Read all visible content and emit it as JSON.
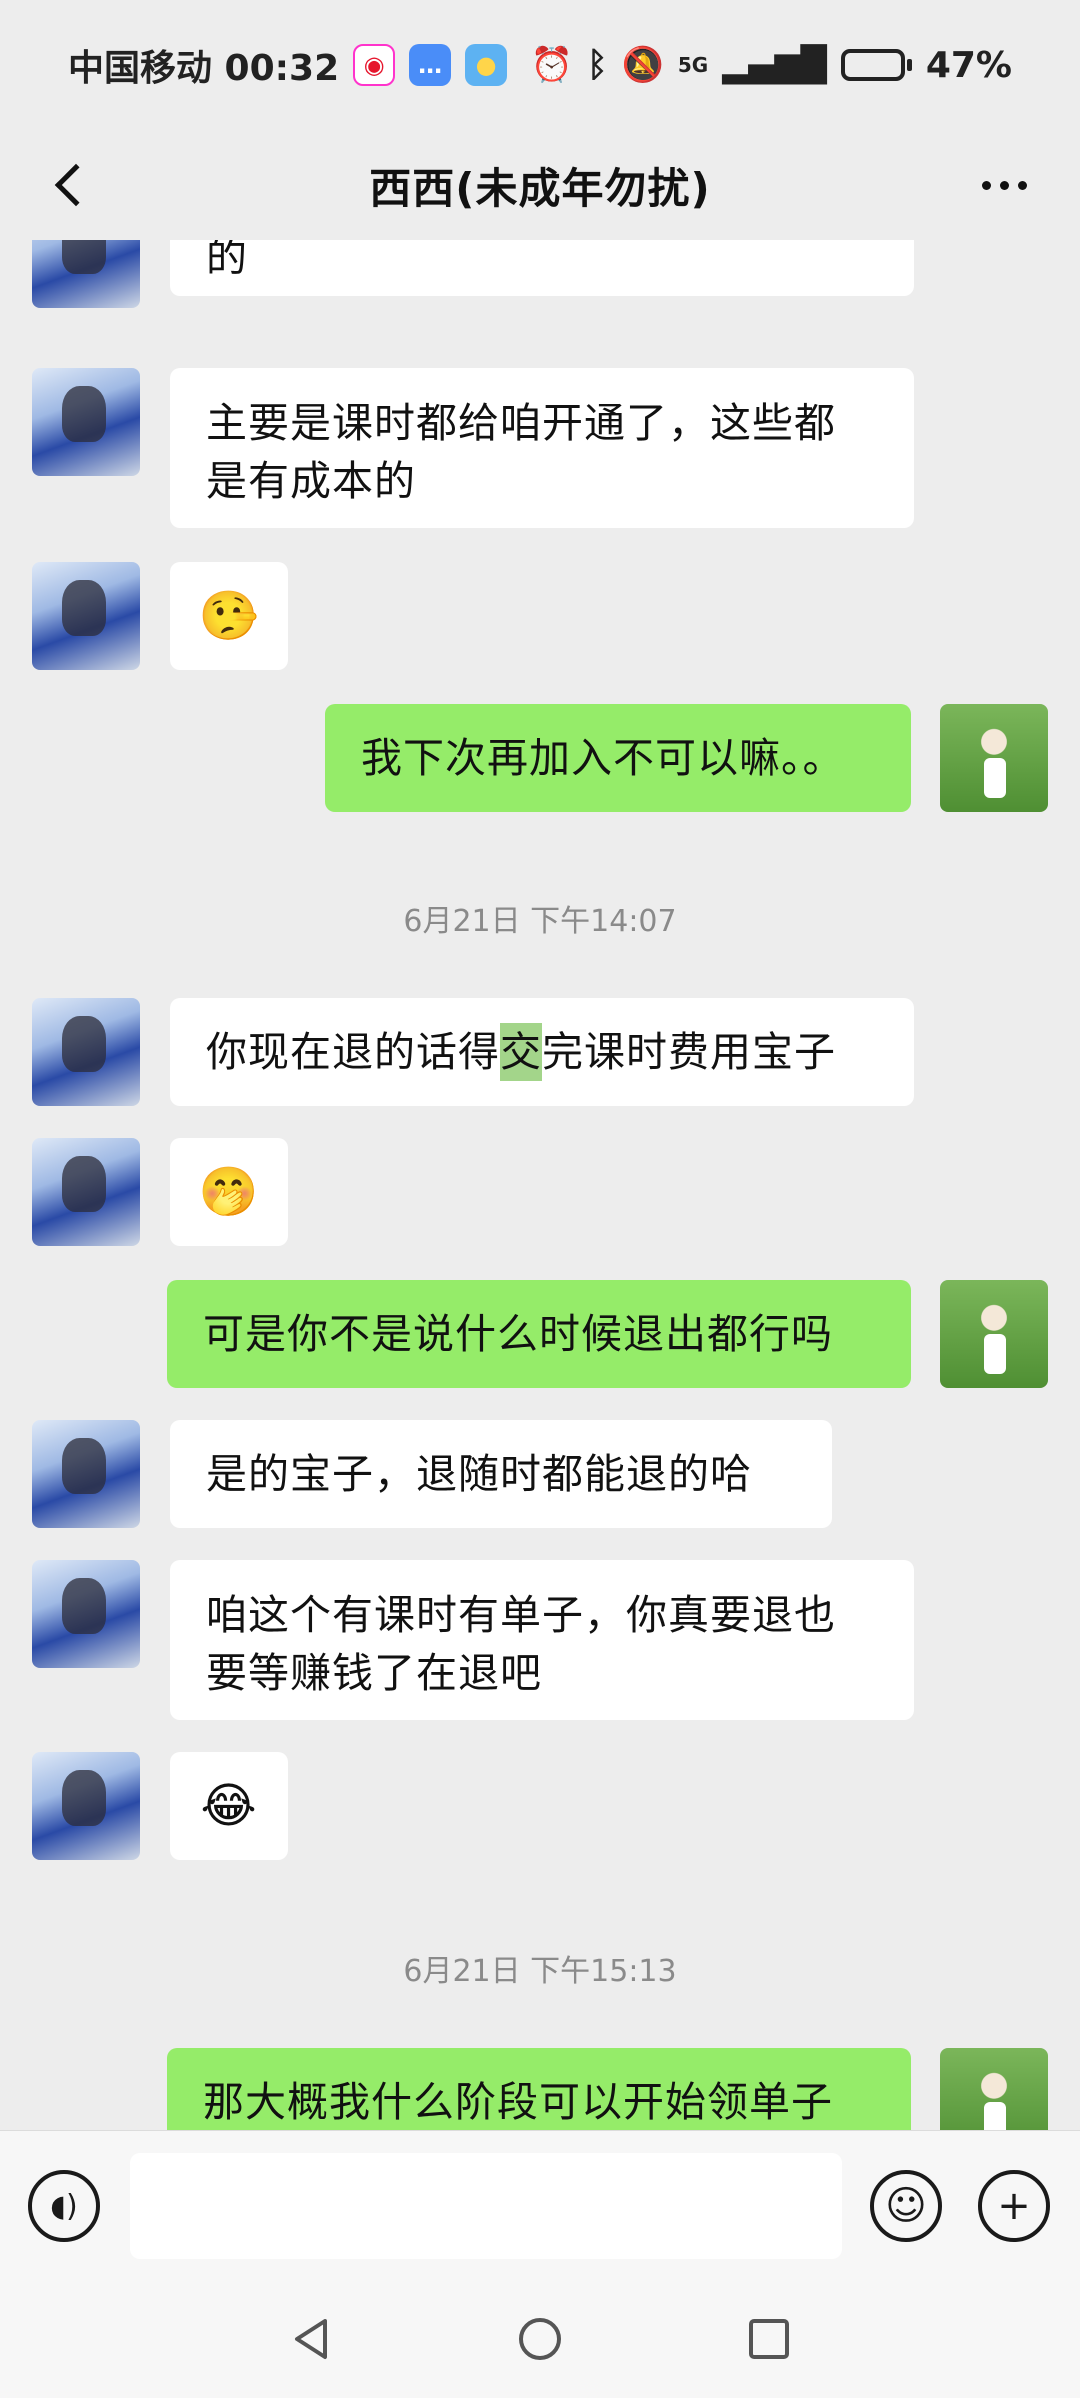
{
  "status_bar": {
    "carrier_time": "中国移动 00:32",
    "network": "5G",
    "battery": "47%",
    "battery_level": 0.47
  },
  "header": {
    "title": "西西(未成年勿扰)"
  },
  "messages": {
    "m0": "的",
    "m1_line1": "主要是课时都给咱开通了，这些都",
    "m1_line2": "是有成本的",
    "m2_emoji": "🤥",
    "m3": "我下次再加入不可以嘛。。",
    "ts1": "6月21日 下午14:07",
    "m4_pre": "你现在退的话得",
    "m4_hl": "交",
    "m4_post": "完课时费用宝子",
    "m5_emoji": "🤭",
    "m6": "可是你不是说什么时候退出都行吗",
    "m7": "是的宝子，退随时都能退的哈",
    "m8_line1": "咱这个有课时有单子，你真要退也",
    "m8_line2": "要等赚钱了在退吧",
    "m9_emoji": "😂",
    "ts2": "6月21日 下午15:13",
    "m10": "那大概我什么阶段可以开始领单子"
  },
  "input": {
    "placeholder": ""
  },
  "icons": {
    "weibo": "weibo-icon",
    "message": "message-app-icon",
    "weather": "weather-icon",
    "alarm": "alarm-icon",
    "bluetooth": "bluetooth-icon",
    "mute": "bell-muted-icon",
    "signal": "signal-icon",
    "battery": "battery-icon"
  },
  "colors": {
    "self_bubble": "#95ec69",
    "other_bubble": "#ffffff",
    "background": "#ededed",
    "highlight": "#a3d58a"
  }
}
